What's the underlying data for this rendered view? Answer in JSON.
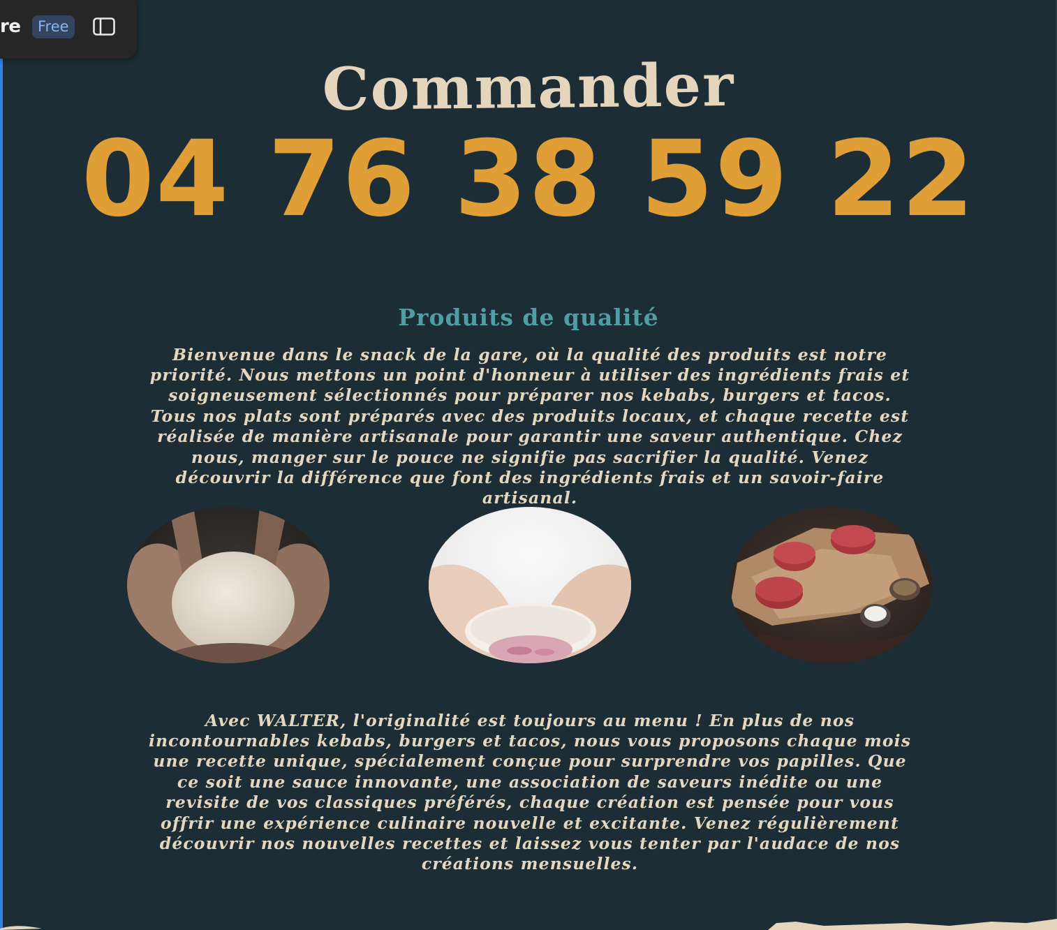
{
  "toolbar": {
    "title_fragment": "re",
    "plan_badge": "Free",
    "sidebar_toggle_icon": "sidebar-toggle-icon"
  },
  "hero": {
    "title": "Commander",
    "phone": "04 76 38 59 22"
  },
  "quality": {
    "heading": "Produits de qualité",
    "paragraph": "Bienvenue dans le snack de la gare, où la qualité des produits est notre priorité. Nous mettons un point d'honneur à utiliser des ingrédients frais et soigneusement sélectionnés pour préparer nos kebabs, burgers et tacos. Tous nos plats sont préparés avec des produits locaux, et chaque recette est réalisée de manière artisanale pour garantir une saveur authentique. Chez nous, manger sur le pouce ne signifie pas sacrifier la qualité. Venez découvrir la différence que font des ingrédients frais et un savoir-faire artisanal."
  },
  "gallery": [
    {
      "subject": "hands-holding-dough-photo"
    },
    {
      "subject": "hands-holding-bowl-of-onions-photo"
    },
    {
      "subject": "raw-beef-steaks-on-paper-photo"
    }
  ],
  "originality": {
    "paragraph": "Avec WALTER, l'originalité est toujours au menu ! En plus de nos incontournables kebabs, burgers et tacos, nous vous proposons chaque mois une recette unique, spécialement conçue pour surprendre vos papilles. Que ce soit une sauce innovante, une association de saveurs inédite ou une revisite de vos classiques préférés, chaque création est pensée pour vous offrir une expérience culinaire nouvelle et excitante. Venez régulièrement découvrir nos nouvelles recettes et laissez vous tenter par l'audace de nos créations mensuelles."
  },
  "colors": {
    "background": "#1c2d35",
    "title": "#e6d5bd",
    "phone": "#e09e36",
    "heading": "#4f9ea4",
    "body_text": "#e4d7c0",
    "toolbar_bg": "#262626",
    "badge_bg": "#34445e",
    "badge_text": "#86b4f3",
    "accent_edge": "#2f86e6"
  }
}
